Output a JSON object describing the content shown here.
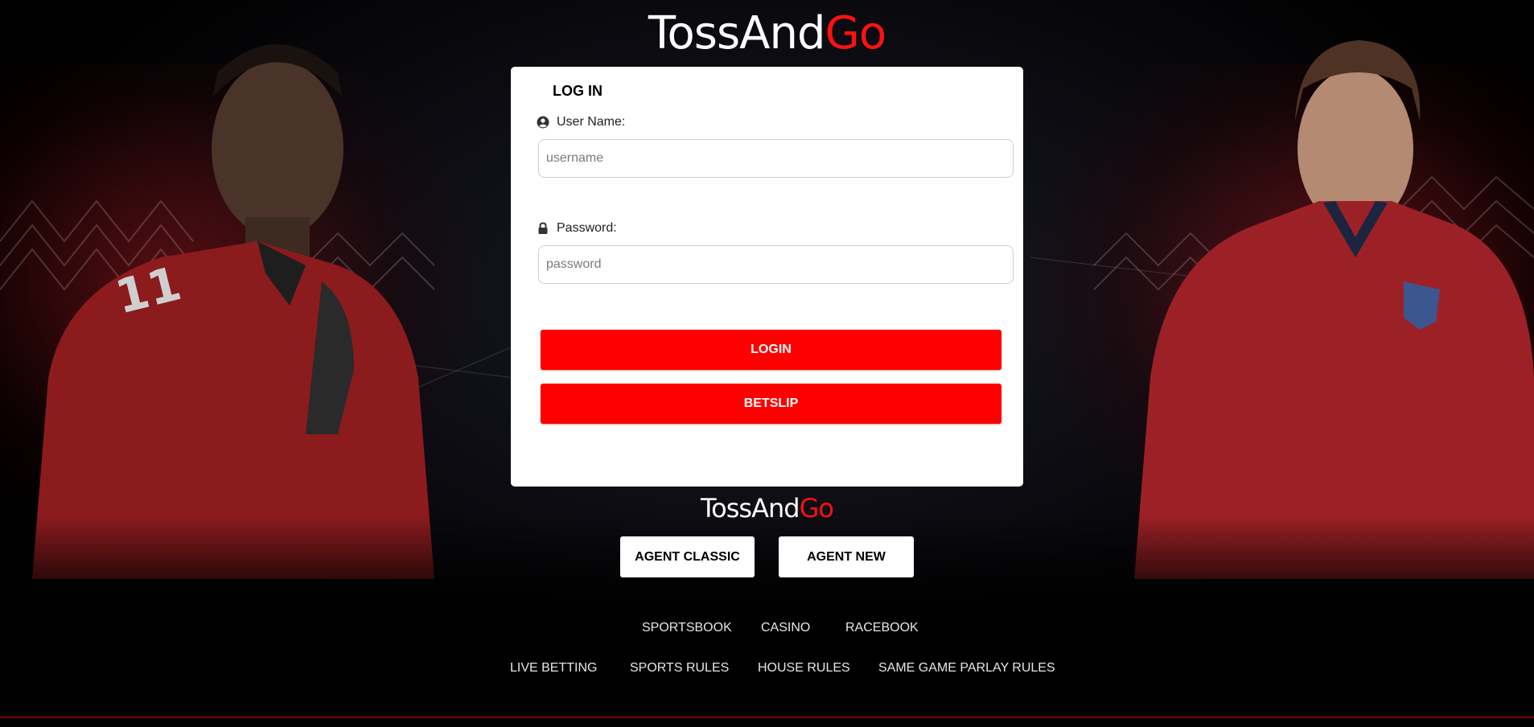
{
  "brand": {
    "name_part1": "Toss",
    "name_part2": "And",
    "name_part3": "Go",
    "accent_color": "#ff0000"
  },
  "login": {
    "title": "LOG IN",
    "username_label": "User Name:",
    "username_placeholder": "username",
    "username_icon": "user-circle-icon",
    "password_label": "Password:",
    "password_placeholder": "password",
    "password_icon": "lock-icon",
    "login_button": "LOGIN",
    "betslip_button": "BETSLIP"
  },
  "agent": {
    "classic_button": "AGENT CLASSIC",
    "new_button": "AGENT NEW"
  },
  "footer": {
    "row1": [
      "SPORTSBOOK",
      "CASINO",
      "RACEBOOK"
    ],
    "row2": [
      "LIVE BETTING",
      "SPORTS RULES",
      "HOUSE RULES",
      "SAME GAME PARLAY RULES"
    ]
  }
}
